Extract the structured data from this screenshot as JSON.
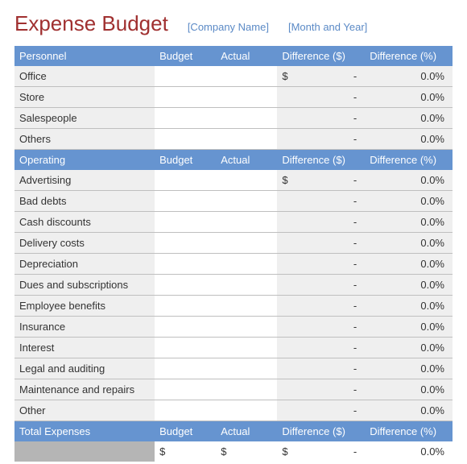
{
  "header": {
    "title": "Expense Budget",
    "company_placeholder": "[Company Name]",
    "date_placeholder": "[Month and Year]"
  },
  "columns": {
    "budget": "Budget",
    "actual": "Actual",
    "diff_dollar": "Difference ($)",
    "diff_percent": "Difference (%)"
  },
  "sections": [
    {
      "name": "Personnel",
      "rows": [
        {
          "label": "Office",
          "budget": "",
          "actual": "",
          "diff_dollar_prefix": "$",
          "diff_dollar": "-",
          "diff_percent": "0.0%"
        },
        {
          "label": "Store",
          "budget": "",
          "actual": "",
          "diff_dollar_prefix": "",
          "diff_dollar": "-",
          "diff_percent": "0.0%"
        },
        {
          "label": "Salespeople",
          "budget": "",
          "actual": "",
          "diff_dollar_prefix": "",
          "diff_dollar": "-",
          "diff_percent": "0.0%"
        },
        {
          "label": "Others",
          "budget": "",
          "actual": "",
          "diff_dollar_prefix": "",
          "diff_dollar": "-",
          "diff_percent": "0.0%"
        }
      ]
    },
    {
      "name": "Operating",
      "rows": [
        {
          "label": "Advertising",
          "budget": "",
          "actual": "",
          "diff_dollar_prefix": "$",
          "diff_dollar": "-",
          "diff_percent": "0.0%"
        },
        {
          "label": "Bad debts",
          "budget": "",
          "actual": "",
          "diff_dollar_prefix": "",
          "diff_dollar": "-",
          "diff_percent": "0.0%"
        },
        {
          "label": "Cash discounts",
          "budget": "",
          "actual": "",
          "diff_dollar_prefix": "",
          "diff_dollar": "-",
          "diff_percent": "0.0%"
        },
        {
          "label": "Delivery costs",
          "budget": "",
          "actual": "",
          "diff_dollar_prefix": "",
          "diff_dollar": "-",
          "diff_percent": "0.0%"
        },
        {
          "label": "Depreciation",
          "budget": "",
          "actual": "",
          "diff_dollar_prefix": "",
          "diff_dollar": "-",
          "diff_percent": "0.0%"
        },
        {
          "label": "Dues and subscriptions",
          "budget": "",
          "actual": "",
          "diff_dollar_prefix": "",
          "diff_dollar": "-",
          "diff_percent": "0.0%"
        },
        {
          "label": "Employee benefits",
          "budget": "",
          "actual": "",
          "diff_dollar_prefix": "",
          "diff_dollar": "-",
          "diff_percent": "0.0%"
        },
        {
          "label": "Insurance",
          "budget": "",
          "actual": "",
          "diff_dollar_prefix": "",
          "diff_dollar": "-",
          "diff_percent": "0.0%"
        },
        {
          "label": "Interest",
          "budget": "",
          "actual": "",
          "diff_dollar_prefix": "",
          "diff_dollar": "-",
          "diff_percent": "0.0%"
        },
        {
          "label": "Legal and auditing",
          "budget": "",
          "actual": "",
          "diff_dollar_prefix": "",
          "diff_dollar": "-",
          "diff_percent": "0.0%"
        },
        {
          "label": "Maintenance and repairs",
          "budget": "",
          "actual": "",
          "diff_dollar_prefix": "",
          "diff_dollar": "-",
          "diff_percent": "0.0%"
        },
        {
          "label": "Other",
          "budget": "",
          "actual": "",
          "diff_dollar_prefix": "",
          "diff_dollar": "-",
          "diff_percent": "0.0%"
        }
      ]
    }
  ],
  "totals": {
    "label": "Total  Expenses",
    "budget": "$",
    "actual": "$",
    "diff_dollar_prefix": "$",
    "diff_dollar": "-",
    "diff_percent": "0.0%"
  }
}
